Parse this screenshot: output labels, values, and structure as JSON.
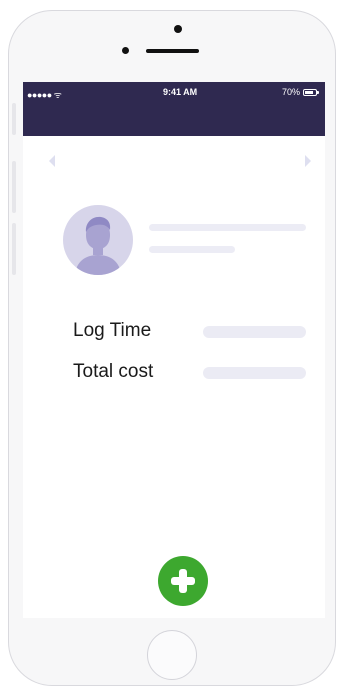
{
  "status_bar": {
    "signal": "●●●●● ᯤ",
    "time": "9:41 AM",
    "battery_percent": "70%"
  },
  "profile": {
    "avatar_icon": "person-silhouette-icon"
  },
  "fields": [
    {
      "label": "Log Time"
    },
    {
      "label": "Total cost"
    }
  ],
  "actions": {
    "add_icon": "plus-circle-icon"
  },
  "colors": {
    "status_bar_bg": "#2f2950",
    "add_button": "#3da82f",
    "avatar_bg": "#d7d5ea",
    "placeholder_bar": "#ebebf4"
  }
}
